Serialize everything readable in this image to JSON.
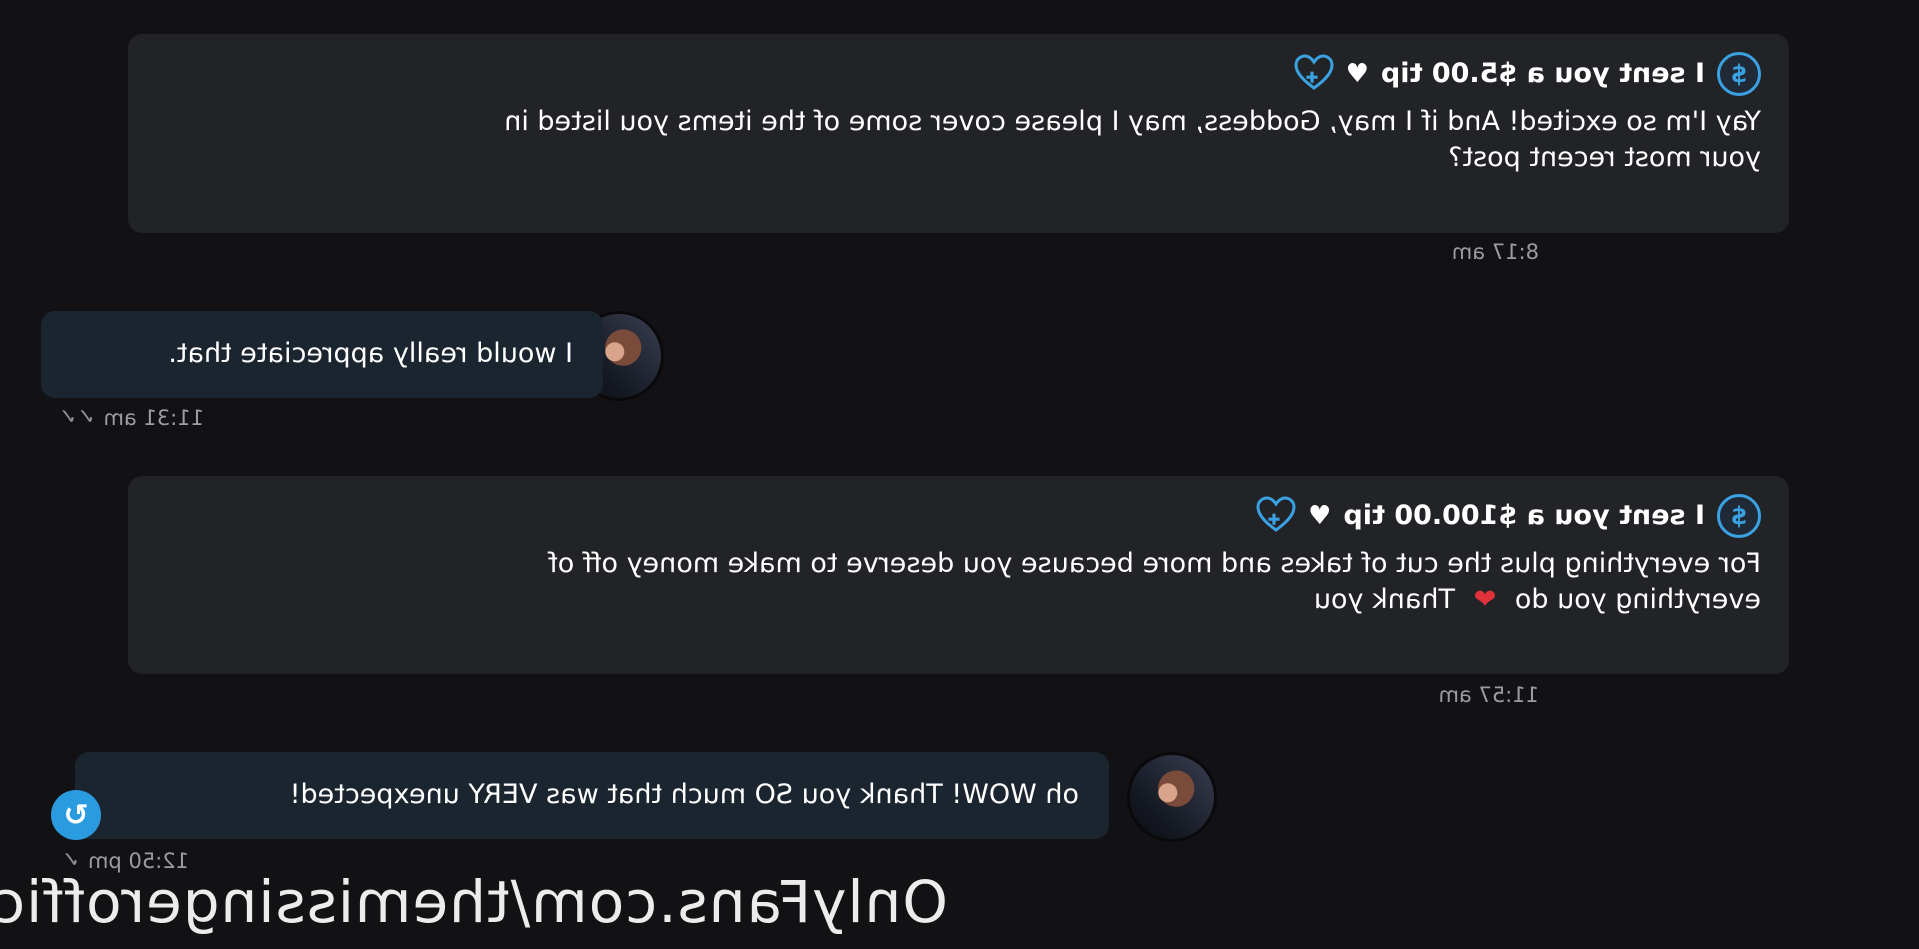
{
  "messages": [
    {
      "tip_label": "I sent you a $5.00 tip",
      "text_line1": "Yay I'm so excited! And if I may, Goddess, may I please cover some of the items you listed in",
      "text_line2": "your most recent post?",
      "time": "8:17 am"
    },
    {
      "text": "I would really appreciate that.",
      "time": "11:31 am"
    },
    {
      "tip_label": "I sent you a $100.00 tip",
      "text_line1": "For everything plus the cut of takes and more because you deserve to make money off of",
      "text_line2_a": "everything you do",
      "text_line2_b": "Thank you",
      "time": "11:57 am"
    },
    {
      "text": "oh WOW! Thank you SO much that was VERY unexpected!",
      "time": "12:50 pm"
    }
  ],
  "watermark": "OnlyFans.com/themissingerofficial",
  "icons": {
    "dollar": "$",
    "white_heart": "♥",
    "red_heart": "❤",
    "check": "✓",
    "double_check": "✓✓",
    "reply": "↻"
  },
  "colors": {
    "accent": "#3aa1e2",
    "background": "#121214",
    "incoming_bubble": "#222326",
    "outgoing_bubble": "#1b2530"
  }
}
